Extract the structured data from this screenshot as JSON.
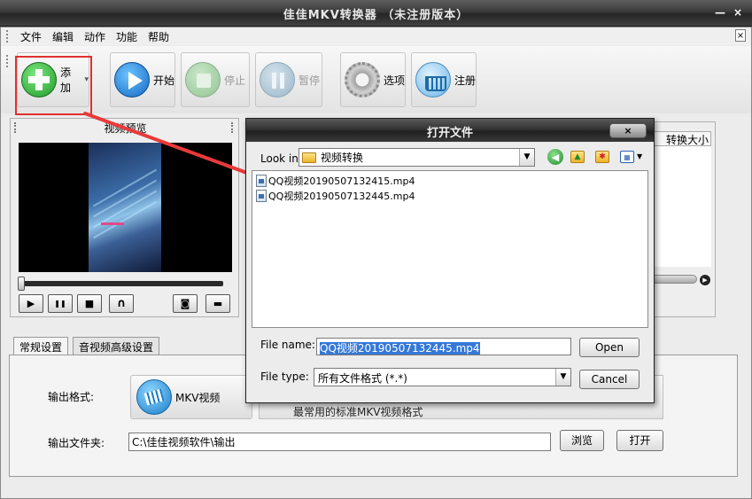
{
  "app": {
    "title": "佳佳MKV转换器   （未注册版本）",
    "window_controls": {
      "minimize": "—",
      "close": "×"
    }
  },
  "menu": {
    "items": [
      "文件",
      "编辑",
      "动作",
      "功能",
      "帮助"
    ],
    "close_glyph": "×"
  },
  "toolbar": {
    "add_label": "添加",
    "add_dropdown_glyph": "▾",
    "start_label": "开始",
    "stop_label": "停止",
    "pause_label": "暂停",
    "options_label": "选项",
    "register_label": "注册"
  },
  "preview": {
    "title": "视频预览",
    "controls": {
      "play": "▶",
      "pause": "❚❚",
      "stop": "■",
      "headphones": "∩",
      "snapshot": "◙",
      "folder": "▬"
    }
  },
  "file_list": {
    "header_size": "转换大小"
  },
  "tabs": {
    "items": [
      "常规设置",
      "音视频高级设置"
    ],
    "active_index": 0
  },
  "settings": {
    "output_format_label": "输出格式:",
    "format_name": "MKV视频",
    "format_description": "最常用的标准MKV视频格式",
    "output_folder_label": "输出文件夹:",
    "output_folder_value": "C:\\佳佳视频软件\\输出",
    "browse_label": "浏览",
    "open_label": "打开"
  },
  "dialog": {
    "title": "打开文件",
    "close_glyph": "×",
    "look_in_label": "Look in:",
    "look_in_value": "视频转换",
    "nav_icons": [
      "back-icon",
      "up-folder-icon",
      "new-folder-icon",
      "view-menu-icon"
    ],
    "files": [
      "QQ视频20190507132415.mp4",
      "QQ视频20190507132445.mp4"
    ],
    "file_name_label": "File name:",
    "file_name_value": "QQ视频20190507132445.mp4",
    "file_type_label": "File type:",
    "file_type_value": "所有文件格式 (*.*)",
    "open_button": "Open",
    "cancel_button": "Cancel"
  },
  "colors": {
    "highlight_border": "#e03030",
    "annotation_arrow": "#e83a3a",
    "selection": "#3478d8"
  }
}
